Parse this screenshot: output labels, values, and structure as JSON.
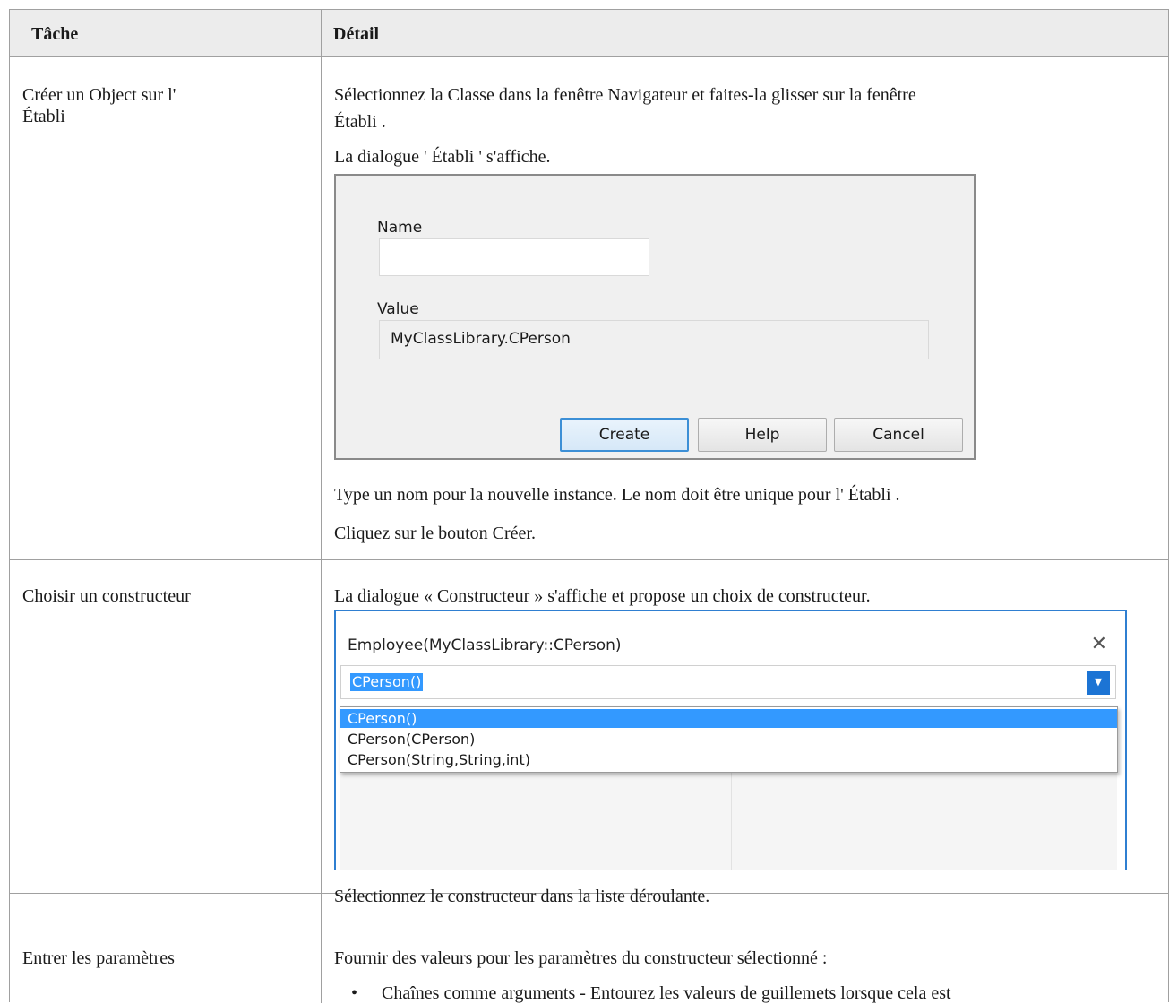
{
  "table": {
    "header": {
      "task": "Tâche",
      "detail": "Détail"
    },
    "rows": [
      {
        "task": "Créer un Object sur l' Établi",
        "intro": "Sélectionnez la Classe dans la fenêtre Navigateur et faites-la glisser sur la fenêtre Établi .",
        "intro_line1": "Sélectionnez la Classe dans la fenêtre Navigateur et faites-la glisser sur la fenêtre",
        "intro_line2": "Établi .",
        "dialog_note": "La dialogue ' Établi ' s'affiche.",
        "after1": "Type un nom pour la nouvelle instance. Le nom doit être unique pour l' Établi .",
        "after2": "Cliquez sur le bouton Créer."
      },
      {
        "task": "Choisir un constructeur",
        "intro": "La dialogue « Constructeur » s'affiche et propose un choix de constructeur.",
        "after": "Sélectionnez le constructeur dans la liste déroulante."
      },
      {
        "task": "Entrer les paramètres",
        "intro": "Fournir des valeurs pour les paramètres du constructeur sélectionné :",
        "bullet": "Chaînes comme arguments - Entourez les valeurs de guillemets lorsque cela est"
      }
    ]
  },
  "workbench_dialog": {
    "name_label": "Name",
    "name_value": "",
    "value_label": "Value",
    "value_value": "MyClassLibrary.CPerson",
    "create_label": "Create",
    "help_label": "Help",
    "cancel_label": "Cancel"
  },
  "constructor_dialog": {
    "title": "Employee(MyClassLibrary::CPerson)",
    "close_icon": "close-icon",
    "selected": "CPerson()",
    "options": [
      "CPerson()",
      "CPerson(CPerson)",
      "CPerson(String,String,int)"
    ]
  }
}
